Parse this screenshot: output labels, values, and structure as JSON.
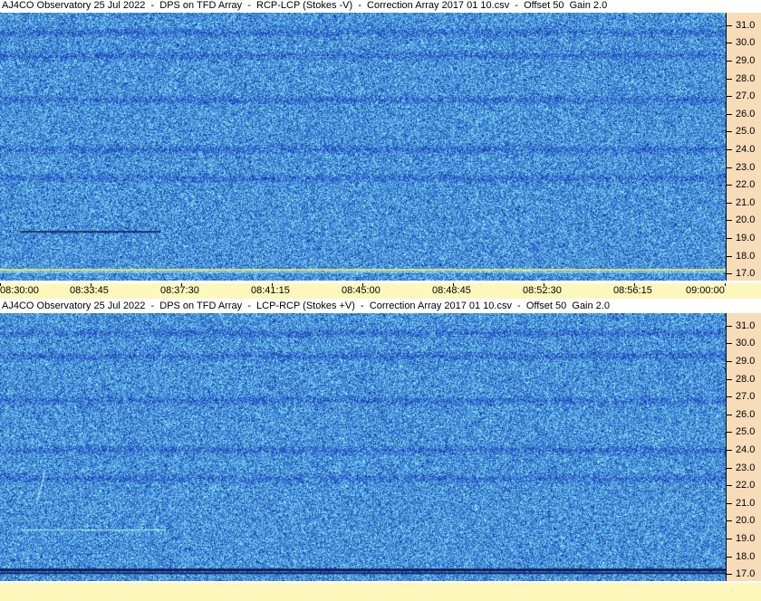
{
  "panels": [
    {
      "title": "AJ4CO Observatory 25 Jul 2022  -  DPS on TFD Array  -  RCP-LCP (Stokes -V)  -  Correction Array 2017 01 10.csv  -  Offset 50  Gain 2.0"
    },
    {
      "title": "AJ4CO Observatory 25 Jul 2022  -  DPS on TFD Array  -  LCP-RCP (Stokes +V)  -  Correction Array 2017 01 10.csv  -  Offset 50  Gain 2.0"
    }
  ],
  "chart_data": {
    "type": "heatmap",
    "x_tick_labels": [
      "08:30:00",
      "08:33:45",
      "08:37:30",
      "08:41:15",
      "08:45:00",
      "08:48:45",
      "08:52:30",
      "08:56:15",
      "09:00:00"
    ],
    "x_range": [
      "08:30:00",
      "09:00:00"
    ],
    "y_tick_labels": [
      "31.0",
      "30.0",
      "29.0",
      "28.0",
      "27.0",
      "26.0",
      "25.0",
      "24.0",
      "23.0",
      "22.0",
      "21.0",
      "20.0",
      "19.0",
      "18.0",
      "17.0"
    ],
    "y_range": [
      16.6,
      31.7
    ],
    "colors": {
      "background": "#2f6fd8",
      "high": "#7ee0ff",
      "low": "#0a1f8c"
    }
  }
}
